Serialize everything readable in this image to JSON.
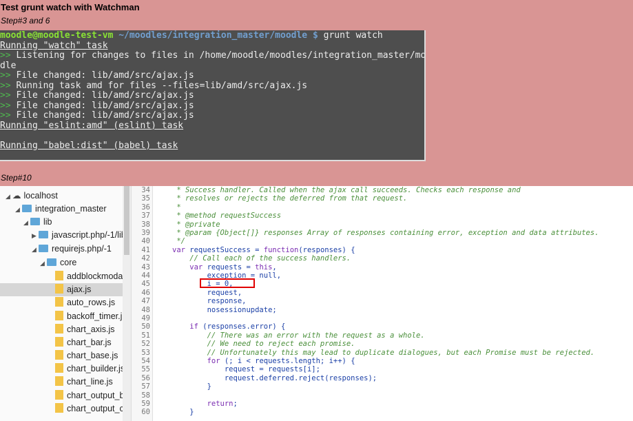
{
  "heading": "Test grunt watch with Watchman",
  "step1": "Step#3 and 6",
  "step2": "Step#10",
  "terminal": {
    "prompt_user": "moodle@moodle-test-vm",
    "prompt_path": " ~/moodles/integration_master/moodle $",
    "command": " grunt watch",
    "l1": "Running \"watch\" task",
    "l2": " Listening for changes to files in /home/moodle/moodles/integration_master/moo",
    "l3": "dle",
    "l4": " File changed: lib/amd/src/ajax.js",
    "l5": " Running task amd for files --files=lib/amd/src/ajax.js",
    "l6": " File changed: lib/amd/src/ajax.js",
    "l7": " File changed: lib/amd/src/ajax.js",
    "l8": " File changed: lib/amd/src/ajax.js",
    "l9": "Running \"eslint:amd\" (eslint) task",
    "l10": "Running \"babel:dist\" (babel) task",
    "arrow": ">>"
  },
  "tree": {
    "localhost": "localhost",
    "integration_master": "integration_master",
    "lib": "lib",
    "javascript": "javascript.php/-1/lib",
    "requirejs": "requirejs.php/-1",
    "core": "core",
    "f1": "addblockmoda",
    "f2": "ajax.js",
    "f3": "auto_rows.js",
    "f4": "backoff_timer.j",
    "f5": "chart_axis.js",
    "f6": "chart_bar.js",
    "f7": "chart_base.js",
    "f8": "chart_builder.js",
    "f9": "chart_line.js",
    "f10": "chart_output_b",
    "f11": "chart_output_c"
  },
  "gutter": [
    "34",
    "35",
    "36",
    "37",
    "38",
    "39",
    "40",
    "41",
    "42",
    "43",
    "44",
    "45",
    "46",
    "47",
    "48",
    "49",
    "50",
    "51",
    "52",
    "53",
    "54",
    "55",
    "56",
    "57",
    "58",
    "59",
    "60"
  ],
  "code": {
    "l34": " * Success handler. Called when the ajax call succeeds. Checks each response and",
    "l35": " * resolves or rejects the deferred from that request.",
    "l36": " *",
    "l37": " * @method requestSuccess",
    "l38": " * @private",
    "l39": " * @param {Object[]} responses Array of responses containing error, exception and data attributes.",
    "l40": " */",
    "l41a": "var",
    "l41b": " requestSuccess = ",
    "l41c": "function",
    "l41d": "(responses) {",
    "l42": "    // Call each of the success handlers.",
    "l43a": "    var",
    "l43b": " requests = ",
    "l43c": "this",
    "l43d": ",",
    "l44": "        exception = null,",
    "l45": "        i = 0,",
    "l46": "        request,",
    "l47": "        response,",
    "l48": "        nosessionupdate;",
    "l49": "",
    "l50a": "    if",
    "l50b": " (responses.error) {",
    "l51": "        // There was an error with the request as a whole.",
    "l52": "        // We need to reject each promise.",
    "l53": "        // Unfortunately this may lead to duplicate dialogues, but each Promise must be rejected.",
    "l54a": "        for",
    "l54b": " (; i < requests.length; i++) {",
    "l55": "            request = requests[i];",
    "l56": "            request.deferred.reject(responses);",
    "l57": "        }",
    "l58": "",
    "l59a": "        return",
    "l59b": ";",
    "l60": "    }"
  }
}
